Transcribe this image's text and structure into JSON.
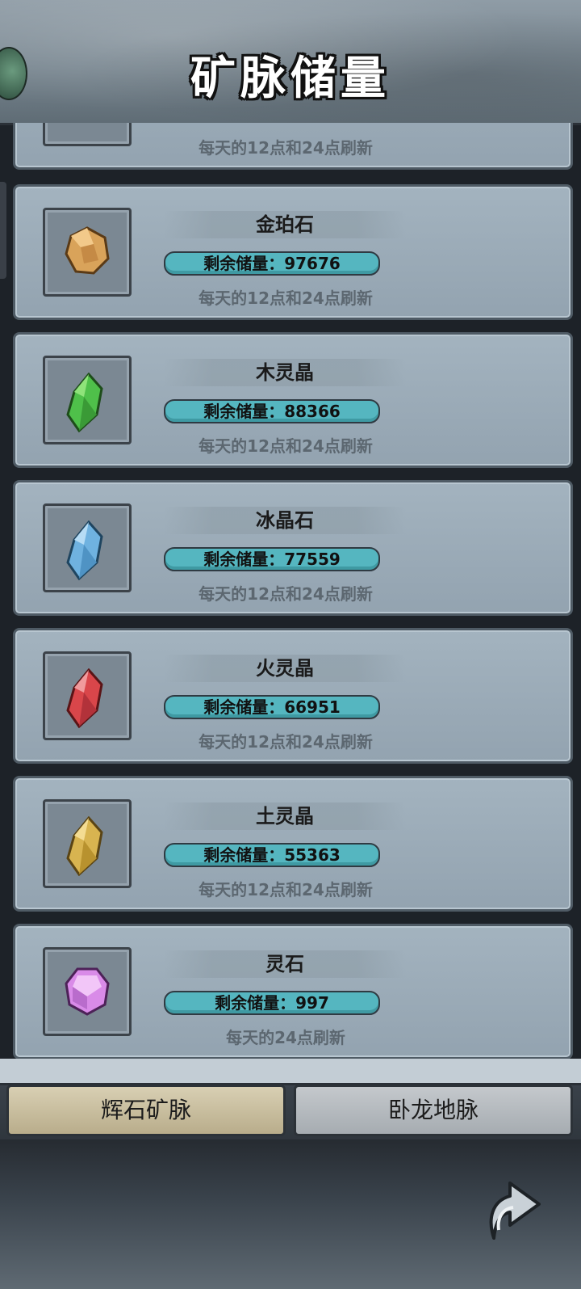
{
  "header": {
    "title": "矿脉储量"
  },
  "partial_card": {
    "note": "每天的12点和24点刷新"
  },
  "cards": [
    {
      "name": "金珀石",
      "storage_label": "剩余储量：97676",
      "note": "每天的12点和24点刷新",
      "icon": "amber-stone-icon",
      "color": "#d9a35a"
    },
    {
      "name": "木灵晶",
      "storage_label": "剩余储量：88366",
      "note": "每天的12点和24点刷新",
      "icon": "wood-crystal-icon",
      "color": "#4fc04a"
    },
    {
      "name": "冰晶石",
      "storage_label": "剩余储量：77559",
      "note": "每天的12点和24点刷新",
      "icon": "ice-crystal-icon",
      "color": "#6fb2e0"
    },
    {
      "name": "火灵晶",
      "storage_label": "剩余储量：66951",
      "note": "每天的12点和24点刷新",
      "icon": "fire-crystal-icon",
      "color": "#d9464a"
    },
    {
      "name": "土灵晶",
      "storage_label": "剩余储量：55363",
      "note": "每天的12点和24点刷新",
      "icon": "earth-crystal-icon",
      "color": "#d8b450"
    },
    {
      "name": "灵石",
      "storage_label": "剩余储量：997",
      "note": "每天的24点刷新",
      "icon": "spirit-stone-icon",
      "color": "#d98be8"
    }
  ],
  "tabs": {
    "tab1": "辉石矿脉",
    "tab2": "卧龙地脉"
  },
  "colors": {
    "bar": "#55b6c0",
    "card": "#9eaebb"
  }
}
